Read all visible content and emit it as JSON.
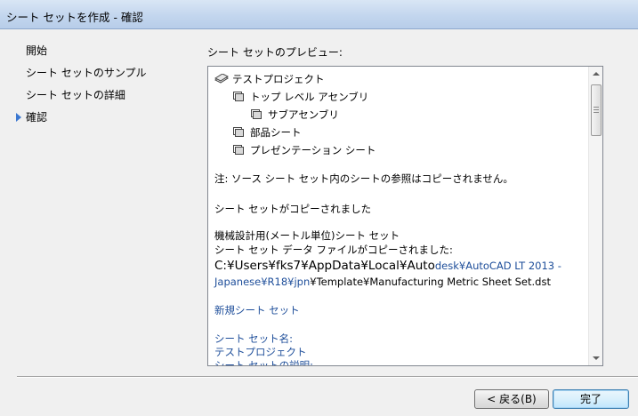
{
  "window": {
    "title": "シート セットを作成 - 確認"
  },
  "nav": {
    "items": [
      {
        "label": "開始",
        "active": false
      },
      {
        "label": "シート セットのサンプル",
        "active": false
      },
      {
        "label": "シート セットの詳細",
        "active": false
      },
      {
        "label": "確認",
        "active": true
      }
    ]
  },
  "preview": {
    "label": "シート セットのプレビュー:",
    "tree": [
      {
        "label": "テストプロジェクト",
        "icon": "sheet-set-icon",
        "level": 0
      },
      {
        "label": "トップ レベル アセンブリ",
        "icon": "subset-icon",
        "level": 1
      },
      {
        "label": "サブアセンブリ",
        "icon": "subset-icon",
        "level": 2
      },
      {
        "label": "部品シート",
        "icon": "subset-icon",
        "level": 1
      },
      {
        "label": "プレゼンテーション シート",
        "icon": "subset-icon",
        "level": 1
      }
    ],
    "note": "注: ソース シート セット内のシートの参照はコピーされません。",
    "copied_message": "シート セットがコピーされました",
    "source_name": "機械設計用(メートル単位)シート セット",
    "copied_from": "シート セット データ ファイルがコピーされました:",
    "path_line1_black": "C:¥Users¥fks7¥AppData¥Local¥Auto",
    "path_line1_blue": "desk¥AutoCAD LT 2013 -",
    "path_line2_blue": "Japanese¥R18¥jpn",
    "path_line2_black": "¥Template¥Manufacturing Metric Sheet Set.dst",
    "new_set_heading": "新規シート セット",
    "name_label": "シート セット名:",
    "name_value": "テストプロジェクト",
    "desc_label": "シート セットの説明:"
  },
  "buttons": {
    "back": "< 戻る(B)",
    "finish": "完了"
  },
  "colors": {
    "accent_blue": "#1e4e9a",
    "nav_arrow": "#3b77d0"
  }
}
